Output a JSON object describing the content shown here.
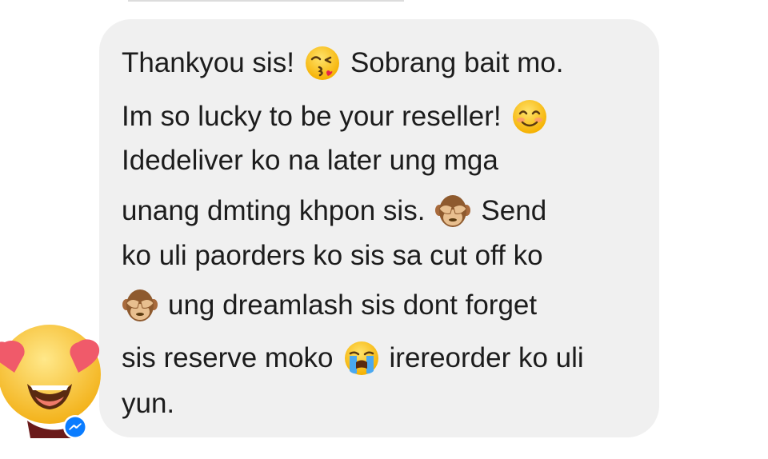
{
  "message": {
    "sender_avatar_icon": "heart-eyes-emoji-avatar",
    "platform_badge_icon": "messenger-icon",
    "lines": [
      {
        "text_a": "Thankyou sis!",
        "emoji": "kissing-face-emoji",
        "text_b": "Sobrang bait mo."
      },
      {
        "text_a": "Im so lucky to be your reseller!",
        "emoji": "smiling-face-emoji",
        "text_b": ""
      },
      {
        "text_a": "Idedeliver ko na later ung mga",
        "emoji": "",
        "text_b": ""
      },
      {
        "text_a": "unang dmting khpon sis.",
        "emoji": "see-no-evil-monkey-emoji",
        "text_b": "Send"
      },
      {
        "text_a": "ko uli paorders ko sis sa cut off ko",
        "emoji": "",
        "text_b": ""
      },
      {
        "text_a": "",
        "emoji": "see-no-evil-monkey-emoji",
        "text_b": "ung dreamlash sis dont forget"
      },
      {
        "text_a": "sis reserve moko",
        "emoji": "loudly-crying-face-emoji",
        "text_b": "irereorder ko uli"
      },
      {
        "text_a": "yun.",
        "emoji": "",
        "text_b": ""
      }
    ]
  },
  "colors": {
    "bubble_bg": "#f0f0f0",
    "text": "#1c1c1c",
    "messenger_blue": "#0a7cff"
  }
}
